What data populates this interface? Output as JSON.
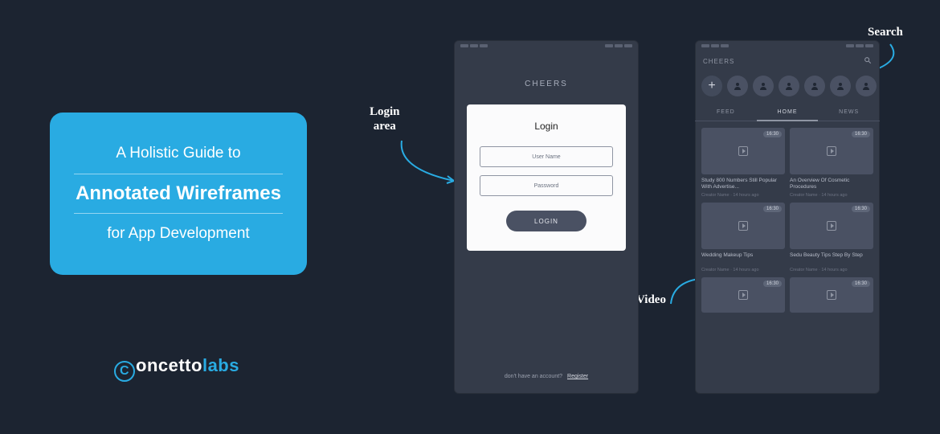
{
  "card": {
    "line1": "A Holistic Guide to",
    "line2": "Annotated Wireframes",
    "line3": "for App Development"
  },
  "logo": {
    "rest": "oncetto",
    "suffix": "labs"
  },
  "annotations": {
    "login": "Login\narea",
    "search": "Search",
    "video": "Video"
  },
  "login_phone": {
    "brand": "CHEERS",
    "panel_title": "Login",
    "username_placeholder": "User Name",
    "password_placeholder": "Password",
    "button": "LOGIN",
    "footer_text": "don't have an account?",
    "footer_link": "Register"
  },
  "feed_phone": {
    "brand": "CHEERS",
    "tabs": [
      "FEED",
      "HOME",
      "NEWS"
    ],
    "active_tab": 1,
    "badge": "16:30",
    "cards": [
      {
        "title": "Study 800 Numbers Still Popular With Advertise...",
        "meta": "Creator Name · 14 hours ago"
      },
      {
        "title": "An Overview Of Cosmetic Procedures",
        "meta": "Creator Name · 14 hours ago"
      },
      {
        "title": "Wedding Makeup Tips",
        "meta": "Creator Name · 14 hours ago"
      },
      {
        "title": "Sedu Beauty Tips Step By Step",
        "meta": "Creator Name · 14 hours ago"
      }
    ]
  }
}
